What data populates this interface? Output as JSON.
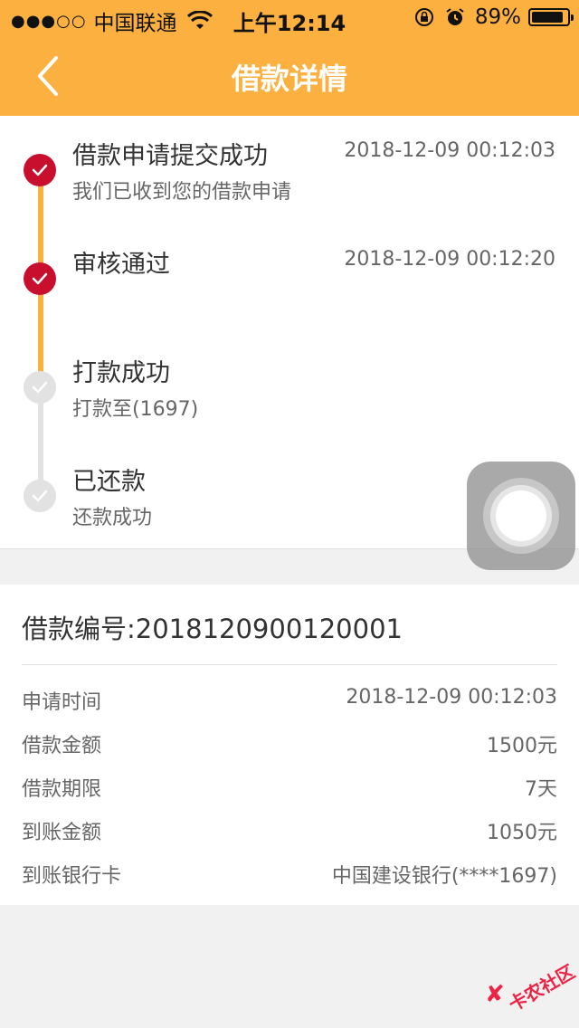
{
  "status_bar": {
    "signal": "●●●○○",
    "carrier": "中国联通",
    "time": "上午12:14",
    "battery_text": "89%",
    "battery_level": 0.89
  },
  "header": {
    "title": "借款详情"
  },
  "timeline": {
    "steps": [
      {
        "title": "借款申请提交成功",
        "subtitle": "我们已收到您的借款申请",
        "time": "2018-12-09 00:12:03",
        "done": true
      },
      {
        "title": "审核通过",
        "subtitle": "",
        "time": "2018-12-09 00:12:20",
        "done": true
      },
      {
        "title": "打款成功",
        "subtitle": "打款至(1697)",
        "time": "",
        "done": false
      },
      {
        "title": "已还款",
        "subtitle": "还款成功",
        "time": "",
        "done": false
      }
    ]
  },
  "loan": {
    "number_label": "借款编号:2018120900120001",
    "rows": [
      {
        "key": "申请时间",
        "value": "2018-12-09 00:12:03"
      },
      {
        "key": "借款金额",
        "value": "1500元"
      },
      {
        "key": "借款期限",
        "value": "7天"
      },
      {
        "key": "到账金额",
        "value": "1050元"
      },
      {
        "key": "到账银行卡",
        "value": "中国建设银行(****1697)"
      }
    ]
  },
  "watermark": {
    "text": "卡农社区"
  },
  "colors": {
    "header_bg": "#fbb040",
    "done_dot": "#c8102e",
    "done_line": "#fbb040",
    "pending": "#e2e2e2"
  }
}
